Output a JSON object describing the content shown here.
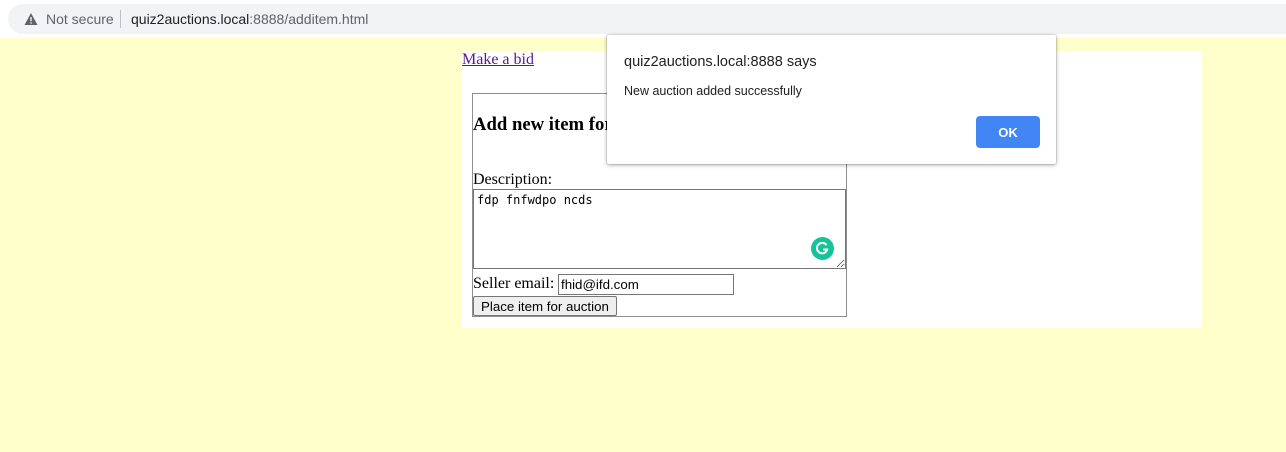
{
  "browser": {
    "security_label": "Not secure",
    "url_host": "quiz2auctions.local",
    "url_rest": ":8888/additem.html",
    "warning_icon": "warning-triangle-icon"
  },
  "page": {
    "bid_link": "Make a bid",
    "form": {
      "heading": "Add new item for auction",
      "description_label": "Description:",
      "description_value": "fdp fnfwdpo ncds",
      "seller_label": "Seller email:",
      "seller_value": "fhid@ifd.com",
      "submit_label": "Place item for auction"
    },
    "grammarly_icon": "grammarly-icon"
  },
  "dialog": {
    "title": "quiz2auctions.local:8888 says",
    "message": "New auction added successfully",
    "ok_label": "OK"
  },
  "colors": {
    "page_background": "#ffffcc",
    "ok_button": "#4285f4",
    "grammarly": "#15c39a",
    "link_visited": "#551a8b"
  }
}
